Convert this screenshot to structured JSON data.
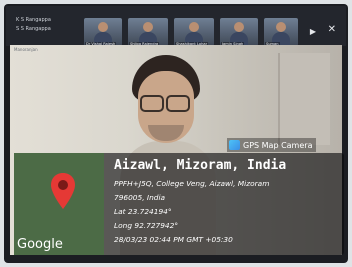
{
  "meeting": {
    "participants": [
      {
        "name": "K S Rangappa"
      },
      {
        "name": "S S Rangappa"
      }
    ],
    "tiles": [
      {
        "label": "Dr Vishal Rajesh"
      },
      {
        "label": "Shilpa Rajendra"
      },
      {
        "label": "Shashikant Lohar"
      },
      {
        "label": "Jamin Singh"
      },
      {
        "label": "Suman"
      }
    ]
  },
  "video": {
    "name_label": "Manoranjan"
  },
  "gps_overlay": {
    "app_name": "GPS Map Camera",
    "map_brand": "Google",
    "location_title": "Aizawl, Mizoram, India",
    "address_line1": "PPFH+J5Q, College Veng, Aizawl, Mizoram",
    "address_line2": "796005, India",
    "latitude": "Lat 23.724194°",
    "longitude": "Long 92.727942°",
    "datetime": "28/03/23 02:44 PM GMT +05:30"
  },
  "colors": {
    "overlay_bg": "#0a0a0c",
    "pin_red": "#e53935",
    "map_green": "#4c6b46"
  },
  "icons": [
    "gps-camera-icon",
    "map-pin-icon",
    "arrow-right-icon",
    "close-icon"
  ]
}
